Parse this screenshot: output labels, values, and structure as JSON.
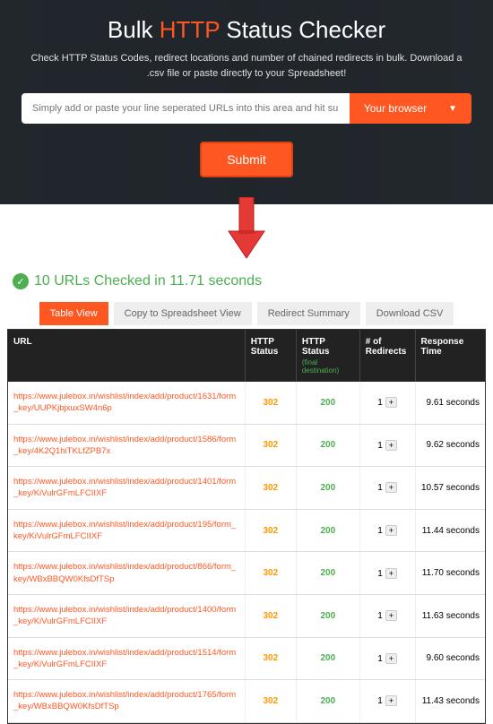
{
  "hero": {
    "title_pre": "Bulk ",
    "title_accent": "HTTP",
    "title_post": " Status Checker",
    "subtitle": "Check HTTP Status Codes, redirect locations and number of chained redirects in bulk. Download a .csv file or paste directly to your Spreadsheet!",
    "input_placeholder": "Simply add or paste your line seperated URLs into this area and hit submit",
    "browser_label": "Your browser",
    "submit_label": "Submit"
  },
  "status": {
    "text": "10 URLs Checked in 11.71 seconds"
  },
  "tabs": [
    {
      "label": "Table View",
      "active": true
    },
    {
      "label": "Copy to Spreadsheet View",
      "active": false
    },
    {
      "label": "Redirect Summary",
      "active": false
    },
    {
      "label": "Download CSV",
      "active": false
    }
  ],
  "table": {
    "headers": {
      "url": "URL",
      "status": "HTTP Status",
      "status_final": "HTTP Status",
      "status_final_sub": "(final destination)",
      "redirects": "# of Redirects",
      "response": "Response Time"
    },
    "rows": [
      {
        "url": "https://www.julebox.in/wishlist/index/add/product/1631/form_key/UUPKjbjxuxSW4n6p",
        "status": "302",
        "final": "200",
        "redirects": "1",
        "time": "9.61 seconds"
      },
      {
        "url": "https://www.julebox.in/wishlist/index/add/product/1586/form_key/4K2Q1hiTKLfZPB7x",
        "status": "302",
        "final": "200",
        "redirects": "1",
        "time": "9.62 seconds"
      },
      {
        "url": "https://www.julebox.in/wishlist/index/add/product/1401/form_key/KiVulrGFmLFCIIXF",
        "status": "302",
        "final": "200",
        "redirects": "1",
        "time": "10.57 seconds"
      },
      {
        "url": "https://www.julebox.in/wishlist/index/add/product/195/form_key/KiVulrGFmLFCIIXF",
        "status": "302",
        "final": "200",
        "redirects": "1",
        "time": "11.44 seconds"
      },
      {
        "url": "https://www.julebox.in/wishlist/index/add/product/866/form_key/WBxBBQW0KfsDfTSp",
        "status": "302",
        "final": "200",
        "redirects": "1",
        "time": "11.70 seconds"
      },
      {
        "url": "https://www.julebox.in/wishlist/index/add/product/1400/form_key/KiVulrGFmLFCIIXF",
        "status": "302",
        "final": "200",
        "redirects": "1",
        "time": "11.63 seconds"
      },
      {
        "url": "https://www.julebox.in/wishlist/index/add/product/1514/form_key/KiVulrGFmLFCIIXF",
        "status": "302",
        "final": "200",
        "redirects": "1",
        "time": "9.60 seconds"
      },
      {
        "url": "https://www.julebox.in/wishlist/index/add/product/1765/form_key/WBxBBQW0KfsDfTSp",
        "status": "302",
        "final": "200",
        "redirects": "1",
        "time": "11.43 seconds"
      }
    ]
  }
}
